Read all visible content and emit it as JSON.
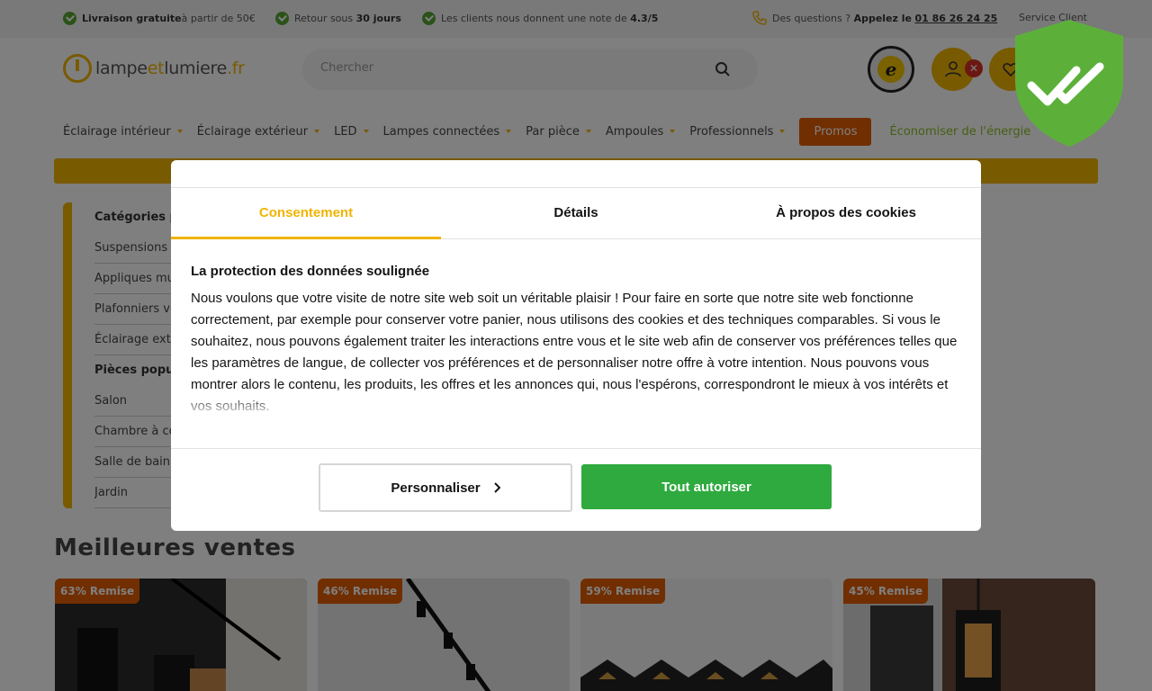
{
  "topbar": {
    "usp1_bold": "Livraison gratuite",
    "usp1_rest": " à partir de 50€",
    "usp2_text": "Retour sous ",
    "usp2_bold": "30 jours",
    "usp3_text": "Les clients nous donnent une note de ",
    "usp3_bold": "4.3/5",
    "contact_text": "Des questions ? ",
    "contact_bold": "Appelez le ",
    "contact_number": "01 86 26 24 25",
    "service": "Service Client"
  },
  "header": {
    "logo_part1": "lampe",
    "logo_part2": "et",
    "logo_part3": "lumiere",
    "logo_part4": ".fr",
    "search_placeholder": "Chercher",
    "badge_error": "✕"
  },
  "nav": {
    "items": [
      {
        "label": "Éclairage intérieur"
      },
      {
        "label": "Éclairage extérieur"
      },
      {
        "label": "LED"
      },
      {
        "label": "Lampes connectées"
      },
      {
        "label": "Par pièce"
      },
      {
        "label": "Ampoules"
      },
      {
        "label": "Professionnels"
      }
    ],
    "promo": "Promos",
    "eco": "Économiser de l'énergie"
  },
  "categories": {
    "heading1": "Catégories populaires",
    "items1": [
      "Suspensions",
      "Appliques murales",
      "Plafonniers verre",
      "Éclairage extérieur"
    ],
    "heading2": "Pièces populaires",
    "items2": [
      "Salon",
      "Chambre à coucher",
      "Salle de bain",
      "Jardin"
    ]
  },
  "bestsellers": {
    "title": "Meilleures ventes",
    "cards": [
      {
        "badge": "63% Remise"
      },
      {
        "badge": "46% Remise"
      },
      {
        "badge": "59% Remise"
      },
      {
        "badge": "45% Remise"
      }
    ]
  },
  "consent": {
    "tabs": [
      "Consentement",
      "Détails",
      "À propos des cookies"
    ],
    "heading": "La protection des données soulignée",
    "body": "Nous voulons que votre visite de notre site web soit un véritable plaisir ! Pour faire en sorte que notre site web fonctionne correctement, par exemple pour conserver votre panier, nous utilisons des cookies et des techniques comparables. Si vous le souhaitez, nous pouvons également traiter les interactions entre vous et le site web afin de conserver vos préférences telles que les paramètres de langue, de collecter vos préférences et de personnaliser notre offre à votre intention. Nous pouvons vous montrer alors le contenu, les produits, les offres et les annonces qui, nous l'espérons, correspondront le mieux à vos intérêts et vos souhaits.",
    "btn_customize": "Personnaliser",
    "btn_accept": "Tout autoriser"
  },
  "colors": {
    "brand_yellow": "#f0b400",
    "promo_orange": "#e25c00",
    "accept_green": "#2eaa3e",
    "shield_green": "#5cb03a"
  }
}
